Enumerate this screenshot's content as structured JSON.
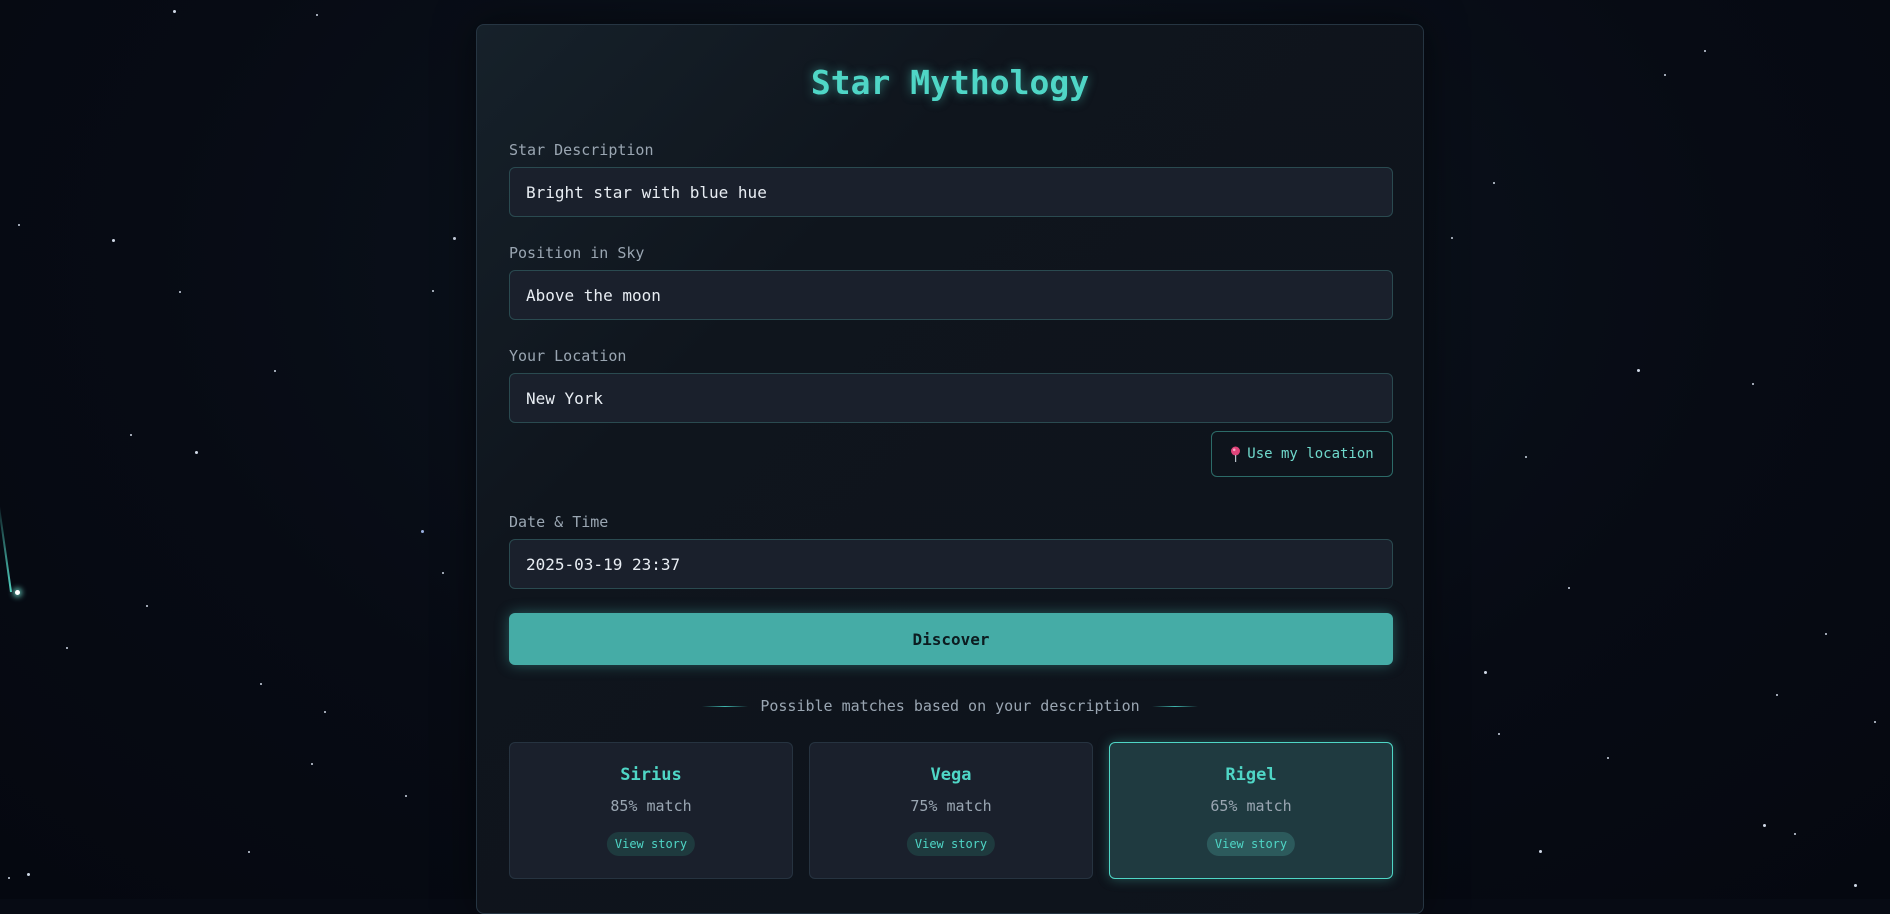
{
  "app": {
    "title": "Star Mythology"
  },
  "form": {
    "description": {
      "label": "Star Description",
      "value": "Bright star with blue hue"
    },
    "position": {
      "label": "Position in Sky",
      "value": "Above the moon"
    },
    "location": {
      "label": "Your Location",
      "value": "New York",
      "use_location_label": "Use my location",
      "use_location_icon": "pin-icon"
    },
    "datetime": {
      "label": "Date & Time",
      "value": "2025-03-19 23:37"
    },
    "discover_label": "Discover"
  },
  "results": {
    "heading": "Possible matches based on your description",
    "matches": [
      {
        "name": "Sirius",
        "match": "85% match",
        "story_label": "View story",
        "selected": false
      },
      {
        "name": "Vega",
        "match": "75% match",
        "story_label": "View story",
        "selected": false
      },
      {
        "name": "Rigel",
        "match": "65% match",
        "story_label": "View story",
        "selected": true
      }
    ]
  },
  "colors": {
    "accent": "#4fd6c6",
    "button": "#45aca6",
    "background": "#070b14",
    "panel": "#0f151d",
    "field": "#1a202c",
    "pin": "#e0447a"
  }
}
